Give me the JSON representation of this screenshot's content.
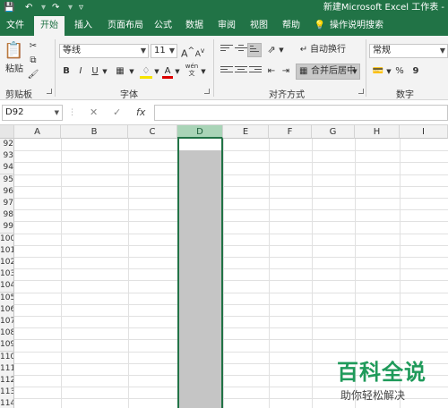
{
  "titlebar": {
    "title": "新建Microsoft Excel 工作表 -",
    "save_icon": "save-icon",
    "undo_icon": "undo-icon",
    "redo_icon": "redo-icon"
  },
  "tabs": [
    "文件",
    "开始",
    "插入",
    "页面布局",
    "公式",
    "数据",
    "审阅",
    "视图",
    "帮助",
    "操作说明搜索"
  ],
  "active_tab": "开始",
  "ribbon": {
    "clipboard": {
      "paste": "粘贴",
      "label": "剪贴板"
    },
    "font": {
      "name": "等线",
      "size": "11",
      "bold": "B",
      "italic": "I",
      "underline": "U",
      "label": "字体",
      "grow": "A",
      "shrink": "A",
      "wen": "wén"
    },
    "alignment": {
      "wrap": "自动换行",
      "merge": "合并后居中",
      "label": "对齐方式"
    },
    "number": {
      "format": "常规",
      "percent": "%",
      "comma": "9",
      "label": "数字"
    }
  },
  "formula_bar": {
    "name_box": "D92",
    "fx": "fx",
    "cancel": "✕",
    "confirm": "✓",
    "value": ""
  },
  "columns": [
    "A",
    "B",
    "C",
    "D",
    "E",
    "F",
    "G",
    "H",
    "I"
  ],
  "selected_column": "D",
  "rows": [
    "92",
    "93",
    "94",
    "95",
    "96",
    "97",
    "98",
    "99",
    "100",
    "101",
    "102",
    "103",
    "104",
    "105",
    "106",
    "107",
    "108",
    "109",
    "110",
    "111",
    "112",
    "113",
    "114"
  ],
  "watermark": {
    "title": "百科全说",
    "subtitle": "助你轻松解决"
  },
  "colors": {
    "excel_green": "#217346",
    "selection_gray": "#c5c5c5",
    "header_selected": "#a9d4b7"
  }
}
